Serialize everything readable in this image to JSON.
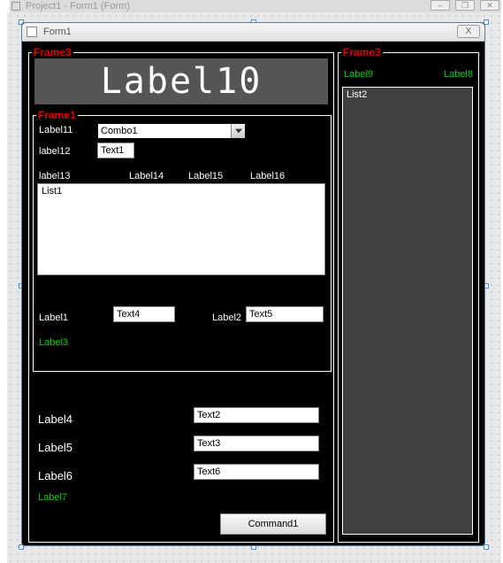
{
  "mdi": {
    "title": "Project1 - Form1 (Form)"
  },
  "form": {
    "title": "Form1",
    "close": "X"
  },
  "frame_left": {
    "legend": "Frame3",
    "big_label": "Label10",
    "inner": {
      "legend": "Frame1",
      "row_combo": {
        "label": "Label11",
        "combo": "Combo1"
      },
      "row_text": {
        "label": "label12",
        "text": "Text1"
      },
      "cols": {
        "c1": "label13",
        "c2": "Label14",
        "c3": "Label15",
        "c4": "Label16"
      },
      "list": "List1"
    },
    "mid": {
      "l1": "Label1",
      "t4": "Text4",
      "l2": "Label2",
      "t5": "Text5",
      "l3": "Label3"
    },
    "lower": {
      "l4": "Label4",
      "t2": "Text2",
      "l5": "Label5",
      "t3": "Text3",
      "l6": "Label6",
      "t6": "Text6",
      "l7": "Label7"
    },
    "cmd": "Command1"
  },
  "frame_right": {
    "legend": "Frame3",
    "l9": "Label9",
    "l8": "Label8",
    "list": "List2"
  }
}
